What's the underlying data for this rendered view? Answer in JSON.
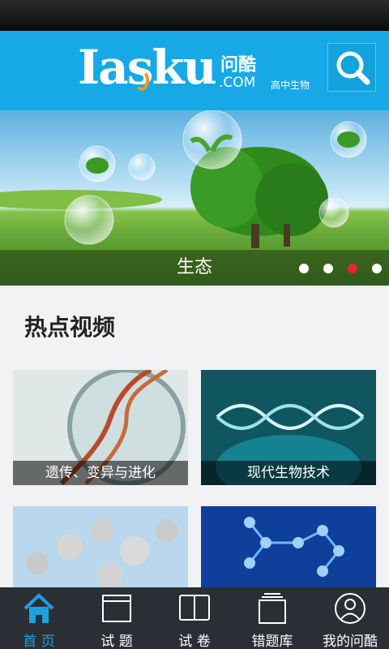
{
  "header": {
    "logo_main": "Iasku",
    "logo_cn": "问酷",
    "logo_domain": ".COM",
    "logo_subject": "高中生物"
  },
  "banner": {
    "caption": "生态",
    "dots": 4,
    "active_dot": 3
  },
  "section": {
    "title": "热点视频"
  },
  "cards": [
    {
      "label": "遗传、变异与进化"
    },
    {
      "label": "现代生物技术"
    },
    {
      "label": ""
    },
    {
      "label": ""
    }
  ],
  "tabs": [
    {
      "label": "首 页",
      "icon": "home-icon",
      "active": true
    },
    {
      "label": "试 题",
      "icon": "window-icon",
      "active": false
    },
    {
      "label": "试 卷",
      "icon": "book-icon",
      "active": false
    },
    {
      "label": "错题库",
      "icon": "stack-icon",
      "active": false
    },
    {
      "label": "我的问酷",
      "icon": "user-icon",
      "active": false
    }
  ],
  "colors": {
    "header_blue": "#16a9e6",
    "active_tab": "#1aa3e0",
    "active_dot": "#e8262b",
    "tabbar_bg": "#2b2f35"
  }
}
